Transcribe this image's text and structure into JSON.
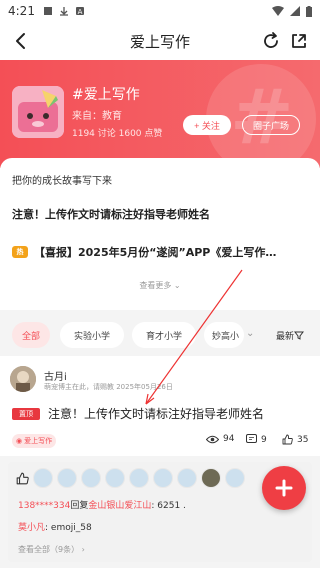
{
  "status_bar": {
    "time": "4:21"
  },
  "nav": {
    "title": "爱上写作"
  },
  "hero": {
    "title": "#爱上写作",
    "source": "来自：教育",
    "stats": "1194 讨论   1600 点赞",
    "follow_label": "+ 关注",
    "square_label": "圈子广场"
  },
  "intro": {
    "text": "把你的成长故事写下来",
    "pinned_1": "注意！上传作文时请标注好指导老师姓名",
    "pinned_2": "【喜报】2025年5月份“遂阅”APP《爱上写作…",
    "see_more": "查看更多"
  },
  "tabs": [
    "全部",
    "实验小学",
    "育才小学",
    "妙高小"
  ],
  "sort_label": "最新",
  "post": {
    "author": "古月i",
    "meta": "萌宠博主在此，请赐教  2025年05月26日",
    "badge": "置顶",
    "title": "注意！上传作文时请标注好指导老师姓名",
    "tag": "爱上写作",
    "views": "94",
    "comments": "9",
    "likes": "35"
  },
  "comments": {
    "c1_name": "138****334",
    "c1_verb": "回复",
    "c1_target": "金山银山爱江山",
    "c1_text": ": 6251 .",
    "c2_name": "莫小凡",
    "c2_text": ": emoji_58",
    "view_all": "查看全部（9条）"
  },
  "colors": {
    "accent": "#f44f56"
  }
}
